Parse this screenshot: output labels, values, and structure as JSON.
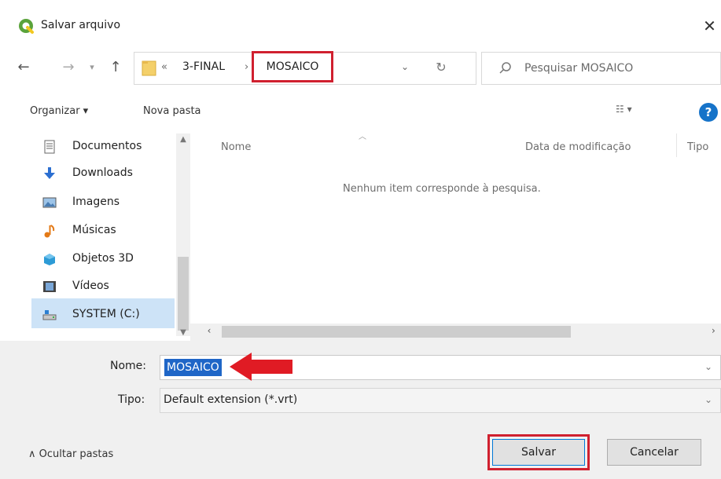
{
  "window": {
    "title": "Salvar arquivo",
    "close_glyph": "✕"
  },
  "icons": {
    "app": "qgis-icon",
    "folder": "folder-icon",
    "search": "search-icon",
    "help": "help-icon"
  },
  "nav": {
    "back_glyph": "←",
    "forward_glyph": "→",
    "recent_glyph": "▾",
    "up_glyph": "↑",
    "refresh_glyph": "↻",
    "dropdown_glyph": "⌄"
  },
  "breadcrumb": {
    "separator_1": "«",
    "crumb_1": "3-FINAL",
    "separator_2": "›",
    "crumb_2": "MOSAICO"
  },
  "search": {
    "placeholder": "Pesquisar MOSAICO"
  },
  "toolbar": {
    "organize_label": "Organizar ▾",
    "new_folder_label": "Nova pasta",
    "view_label": "☷ ▾",
    "help_label": "?"
  },
  "sidebar": {
    "items": [
      {
        "label": "Documentos",
        "icon": "documents-icon"
      },
      {
        "label": "Downloads",
        "icon": "downloads-icon"
      },
      {
        "label": "Imagens",
        "icon": "pictures-icon"
      },
      {
        "label": "Músicas",
        "icon": "music-icon"
      },
      {
        "label": "Objetos 3D",
        "icon": "3d-objects-icon"
      },
      {
        "label": "Vídeos",
        "icon": "videos-icon"
      },
      {
        "label": "SYSTEM (C:)",
        "icon": "drive-icon"
      }
    ],
    "selected_item": "SYSTEM (C:)"
  },
  "filelist": {
    "columns": [
      "Nome",
      "Data de modificação",
      "Tipo"
    ],
    "empty_message": "Nenhum item corresponde à pesquisa."
  },
  "form": {
    "name_label": "Nome:",
    "name_value": "MOSAICO",
    "type_label": "Tipo:",
    "type_value": "Default extension (*.vrt)"
  },
  "footer": {
    "hide_folders_label": "∧  Ocultar pastas",
    "save_label": "Salvar",
    "cancel_label": "Cancelar"
  },
  "colors": {
    "highlight_red": "#d0202f",
    "selection_blue": "#1f66c7",
    "accent": "#0078d7"
  }
}
